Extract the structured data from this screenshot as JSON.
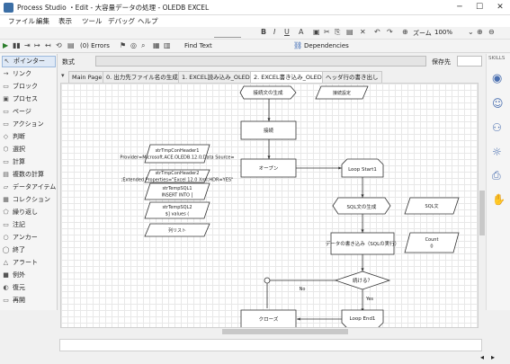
{
  "window": {
    "title": "Process Studio ・Edit - 大容量データの処理 - OLEDB EXCEL",
    "minimize": "─",
    "maximize": "☐",
    "close": "✕"
  },
  "menu": [
    "ファイル",
    "編集",
    "表示",
    "ツール",
    "デバッグ",
    "ヘルプ"
  ],
  "format_bar": {
    "bold": "B",
    "italic": "I",
    "underline": "U",
    "zoom_label": "ズーム",
    "zoom_value": "100%"
  },
  "toolbar": {
    "errors": "(0) Errors",
    "find_text": "Find Text",
    "dependencies": "Dependencies"
  },
  "tools": [
    {
      "label": "ポインター",
      "icon": "pointer-icon",
      "glyph": "↖"
    },
    {
      "label": "リンク",
      "icon": "link-icon",
      "glyph": "→"
    },
    {
      "label": "ブロック",
      "icon": "block-icon",
      "glyph": "▭"
    },
    {
      "label": "プロセス",
      "icon": "process-icon",
      "glyph": "▣"
    },
    {
      "label": "ページ",
      "icon": "page-icon",
      "glyph": "▭"
    },
    {
      "label": "アクション",
      "icon": "action-icon",
      "glyph": "▭"
    },
    {
      "label": "判断",
      "icon": "decision-icon",
      "glyph": "◇"
    },
    {
      "label": "選択",
      "icon": "choice-icon",
      "glyph": "⬡"
    },
    {
      "label": "計算",
      "icon": "calculation-icon",
      "glyph": "▭"
    },
    {
      "label": "複数の計算",
      "icon": "multi-calculation-icon",
      "glyph": "▤"
    },
    {
      "label": "データアイテム",
      "icon": "data-item-icon",
      "glyph": "▱"
    },
    {
      "label": "コレクション",
      "icon": "collection-icon",
      "glyph": "▦"
    },
    {
      "label": "繰り返し",
      "icon": "loop-icon",
      "glyph": "⬠"
    },
    {
      "label": "注記",
      "icon": "note-icon",
      "glyph": "▭"
    },
    {
      "label": "アンカー",
      "icon": "anchor-icon",
      "glyph": "○"
    },
    {
      "label": "終了",
      "icon": "end-icon",
      "glyph": "◯"
    },
    {
      "label": "アラート",
      "icon": "alert-icon",
      "glyph": "△"
    },
    {
      "label": "例外",
      "icon": "exception-icon",
      "glyph": "■"
    },
    {
      "label": "復元",
      "icon": "recover-icon",
      "glyph": "◐"
    },
    {
      "label": "再開",
      "icon": "resume-icon",
      "glyph": "▭"
    }
  ],
  "expression": {
    "label": "数式",
    "save_label": "保存先",
    "value": ""
  },
  "tabs": [
    "Main Page",
    "0. 出力先ファイル名の生成",
    "1. EXCEL読み込み_OLEDB",
    "2. EXCEL書き込み_OLEDB",
    "ヘッダ行の書き出し"
  ],
  "active_tab": 3,
  "skills_label": "SKILLS",
  "flow": {
    "start": "接続文の生成",
    "stage_setting": "接続設定",
    "connect": "接続",
    "open": "オープン",
    "loop_start": "Loop Start1",
    "sql_gen": "SQL文の生成",
    "sql_text": "SQL文",
    "write": "データの書き込み（SQLの実行）",
    "count_label": "Count",
    "count_value": "0",
    "continue_q": "続ける？",
    "yes": "Yes",
    "no": "No",
    "loop_end": "Loop End1",
    "close": "クローズ",
    "data_items": [
      "strTmpConHeader1\nProvider=Microsoft.ACE.OLEDB.12.0;Data Source=",
      "strTmpConHeader2\n;Extended Properties=\"Excel 12.0 Xml;HDR=YES\"",
      "strTempSQL1\nINSERT INTO [",
      "strTempSQL2\n$] values (",
      "列リスト"
    ]
  },
  "colors": {
    "accent": "#4a6fb0",
    "shape_stroke": "#333333",
    "grid": "#e8e8e8"
  }
}
